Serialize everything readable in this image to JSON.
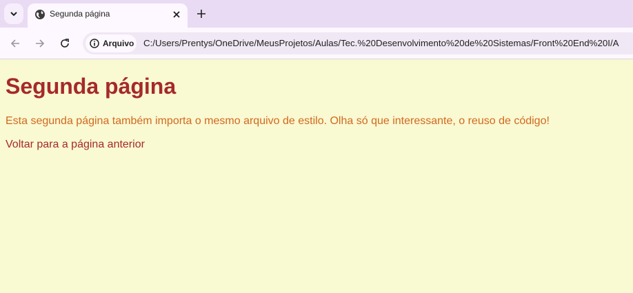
{
  "browser": {
    "tab": {
      "title": "Segunda página"
    },
    "address": {
      "chip_label": "Arquivo",
      "url": "C:/Users/Prentys/OneDrive/MeusProjetos/Aulas/Tec.%20Desenvolvimento%20de%20Sistemas/Front%20End%20I/A"
    }
  },
  "page": {
    "heading": "Segunda página",
    "paragraph": "Esta segunda página também importa o mesmo arquivo de estilo. Olha só que interessante, o reuso de código!",
    "link": "Voltar para a página anterior"
  },
  "colors": {
    "background": "#f9f9d2",
    "heading": "#a52a2a",
    "paragraph": "#d2691e",
    "link": "#a52a2a"
  }
}
